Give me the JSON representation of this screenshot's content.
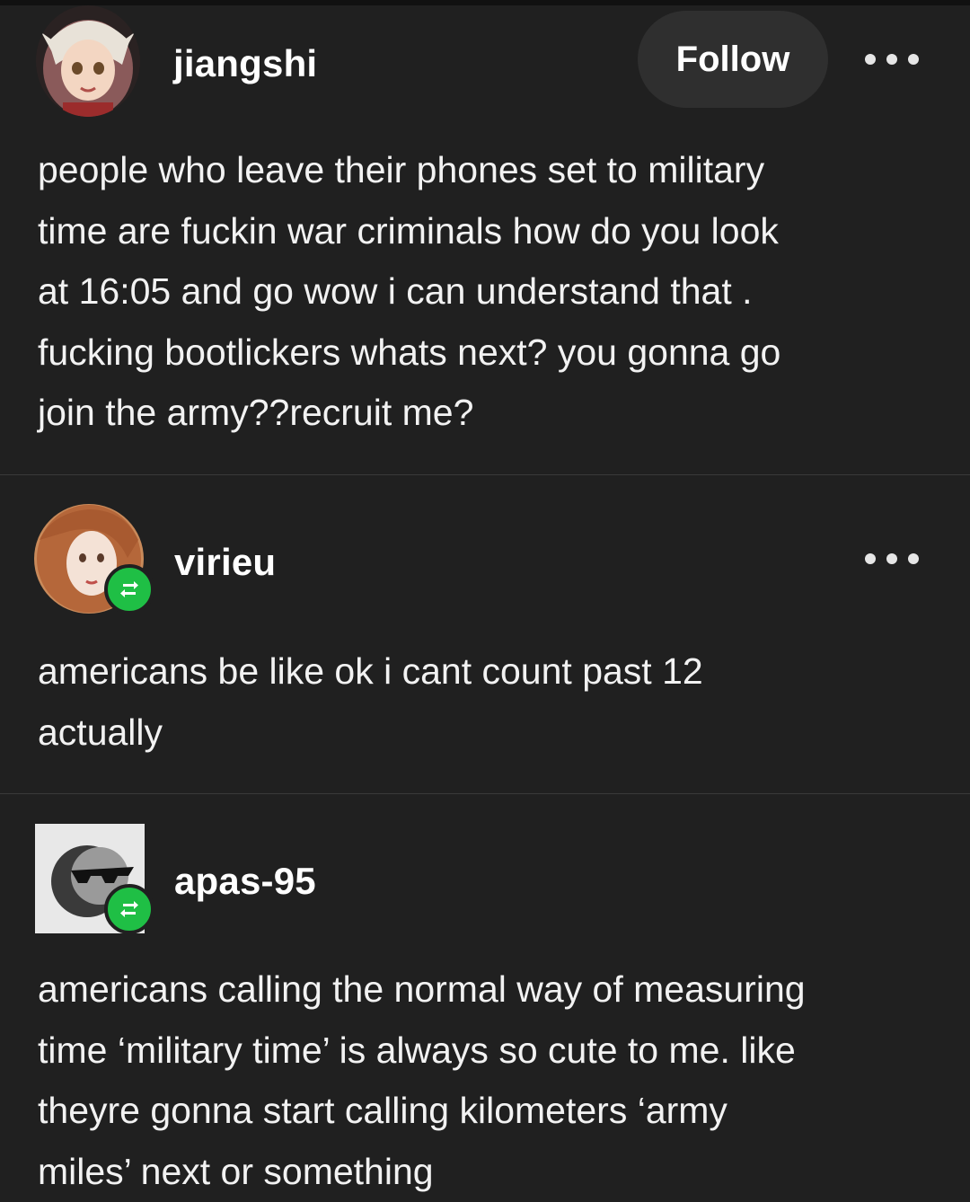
{
  "posts": [
    {
      "username": "jiangshi",
      "follow_label": "Follow",
      "text": "people who leave their phones set to military\ntime are fuckin war criminals how do you look\nat 16:05 and go wow i can understand that .\nfucking bootlickers whats next? you gonna go\njoin the army??recruit me?"
    },
    {
      "username": "virieu",
      "text": "americans be like ok i cant count past 12\nactually"
    },
    {
      "username": "apas-95",
      "text": "americans calling the normal way of measuring\ntime ‘military time’ is always so cute to me. like\ntheyre gonna start calling kilometers ‘army\nmiles’ next or something"
    }
  ],
  "icons": {
    "more": "more-options-icon",
    "reblog": "reblog-icon"
  },
  "colors": {
    "background": "#202020",
    "follow_button": "#2f2f2f",
    "reblog_badge": "#1fbf45",
    "text": "#f2f2f2"
  }
}
